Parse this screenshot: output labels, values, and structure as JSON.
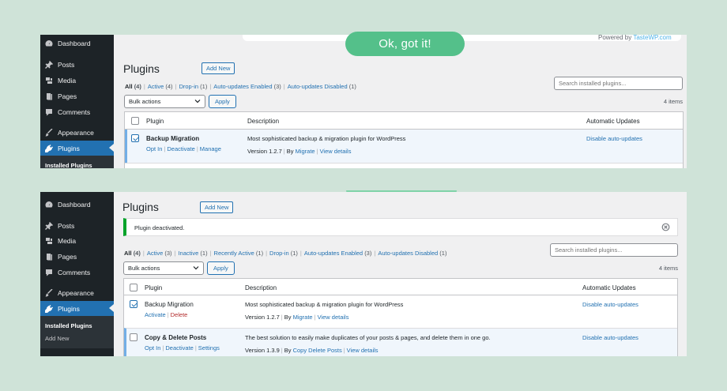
{
  "colors": {
    "background": "#cfe3d8",
    "sidebar": "#1d2327",
    "accent": "#2271b1",
    "ok_button": "#54c08a",
    "notice_border": "#00a32a"
  },
  "top_banner": {
    "ok_label": "Ok, got it!",
    "powered_prefix": "Powered by",
    "powered_brand": "TasteWP.com"
  },
  "shot1": {
    "sidebar": {
      "items": [
        {
          "label": "Dashboard",
          "icon": "dashboard-icon"
        },
        {
          "label": "Posts",
          "icon": "pin-icon"
        },
        {
          "label": "Media",
          "icon": "media-icon"
        },
        {
          "label": "Pages",
          "icon": "pages-icon"
        },
        {
          "label": "Comments",
          "icon": "comment-icon"
        },
        {
          "label": "Appearance",
          "icon": "brush-icon"
        },
        {
          "label": "Plugins",
          "icon": "plug-icon"
        }
      ],
      "sub": [
        "Installed Plugins"
      ]
    },
    "title": "Plugins",
    "add_new": "Add New",
    "filters": {
      "all": "All",
      "all_count": "(4)",
      "active": "Active",
      "active_count": "(4)",
      "dropin": "Drop-in",
      "dropin_count": "(1)",
      "auto_enabled": "Auto-updates Enabled",
      "auto_enabled_count": "(3)",
      "auto_disabled": "Auto-updates Disabled",
      "auto_disabled_count": "(1)"
    },
    "search_placeholder": "Search installed plugins...",
    "bulk_actions": "Bulk actions",
    "apply": "Apply",
    "items_count": "4 items",
    "columns": {
      "plugin": "Plugin",
      "description": "Description",
      "auto": "Automatic Updates"
    },
    "rows": [
      {
        "name": "Backup Migration",
        "actions": [
          "Opt In",
          "Deactivate",
          "Manage"
        ],
        "description": "Most sophisticated backup & migration plugin for WordPress",
        "version": "Version 1.2.7",
        "by": "By",
        "author": "Migrate",
        "details": "View details",
        "auto": "Disable auto-updates"
      }
    ]
  },
  "shot2": {
    "sidebar": {
      "items": [
        {
          "label": "Dashboard",
          "icon": "dashboard-icon"
        },
        {
          "label": "Posts",
          "icon": "pin-icon"
        },
        {
          "label": "Media",
          "icon": "media-icon"
        },
        {
          "label": "Pages",
          "icon": "pages-icon"
        },
        {
          "label": "Comments",
          "icon": "comment-icon"
        },
        {
          "label": "Appearance",
          "icon": "brush-icon"
        },
        {
          "label": "Plugins",
          "icon": "plug-icon"
        }
      ],
      "sub": [
        "Installed Plugins",
        "Add New"
      ]
    },
    "title": "Plugins",
    "add_new": "Add New",
    "notice": "Plugin deactivated.",
    "filters": {
      "all": "All",
      "all_count": "(4)",
      "active": "Active",
      "active_count": "(3)",
      "inactive": "Inactive",
      "inactive_count": "(1)",
      "recently": "Recently Active",
      "recently_count": "(1)",
      "dropin": "Drop-in",
      "dropin_count": "(1)",
      "auto_enabled": "Auto-updates Enabled",
      "auto_enabled_count": "(3)",
      "auto_disabled": "Auto-updates Disabled",
      "auto_disabled_count": "(1)"
    },
    "search_placeholder": "Search installed plugins...",
    "bulk_actions": "Bulk actions",
    "apply": "Apply",
    "items_count": "4 items",
    "columns": {
      "plugin": "Plugin",
      "description": "Description",
      "auto": "Automatic Updates"
    },
    "rows": [
      {
        "name": "Backup Migration",
        "actions": [
          "Activate",
          "Delete"
        ],
        "description": "Most sophisticated backup & migration plugin for WordPress",
        "version": "Version 1.2.7",
        "by": "By",
        "author": "Migrate",
        "details": "View details",
        "auto": "Disable auto-updates"
      },
      {
        "name": "Copy & Delete Posts",
        "actions": [
          "Opt In",
          "Deactivate",
          "Settings"
        ],
        "description": "The best solution to easily make duplicates of your posts & pages, and delete them in one go.",
        "version": "Version 1.3.9",
        "by": "By",
        "author": "Copy Delete Posts",
        "details": "View details",
        "auto": "Disable auto-updates"
      }
    ]
  }
}
